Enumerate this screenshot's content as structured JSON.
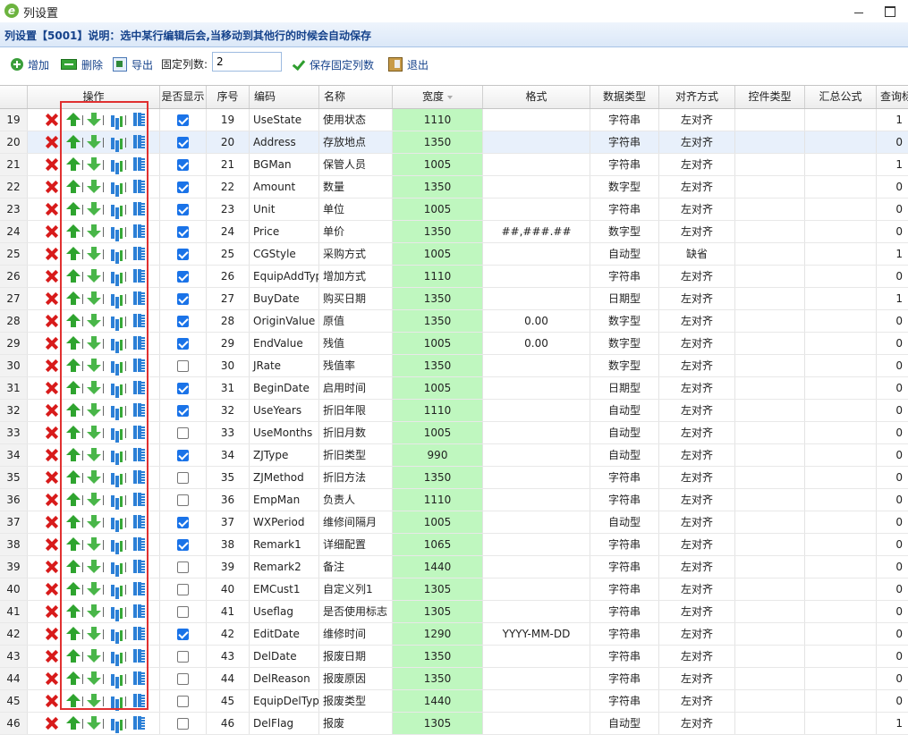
{
  "window": {
    "title": "列设置"
  },
  "info": {
    "text": "列设置【5001】说明：选中某行编辑后会,当移动到其他行的时候会自动保存"
  },
  "toolbar": {
    "add_label": "增加",
    "delete_label": "删除",
    "export_label": "导出",
    "fixed_cols_label": "固定列数:",
    "fixed_cols_value": "2",
    "save_fixed_label": "保存固定列数",
    "exit_label": "退出"
  },
  "columns": [
    "",
    "操作",
    "是否显示",
    "序号",
    "编码",
    "名称",
    "宽度",
    "格式",
    "数据类型",
    "对齐方式",
    "控件类型",
    "汇总公式",
    "查询标"
  ],
  "selected_row": 1,
  "rows": [
    {
      "rn": "19",
      "show": true,
      "seq": "19",
      "code": "UseState",
      "name": "使用状态",
      "width": "1110",
      "fmt": "",
      "type": "字符串",
      "align": "左对齐",
      "query": "1"
    },
    {
      "rn": "20",
      "show": true,
      "seq": "20",
      "code": "Address",
      "name": "存放地点",
      "width": "1350",
      "fmt": "",
      "type": "字符串",
      "align": "左对齐",
      "query": "0"
    },
    {
      "rn": "21",
      "show": true,
      "seq": "21",
      "code": "BGMan",
      "name": "保管人员",
      "width": "1005",
      "fmt": "",
      "type": "字符串",
      "align": "左对齐",
      "query": "1"
    },
    {
      "rn": "22",
      "show": true,
      "seq": "22",
      "code": "Amount",
      "name": "数量",
      "width": "1350",
      "fmt": "",
      "type": "数字型",
      "align": "左对齐",
      "query": "0"
    },
    {
      "rn": "23",
      "show": true,
      "seq": "23",
      "code": "Unit",
      "name": "单位",
      "width": "1005",
      "fmt": "",
      "type": "字符串",
      "align": "左对齐",
      "query": "0"
    },
    {
      "rn": "24",
      "show": true,
      "seq": "24",
      "code": "Price",
      "name": "单价",
      "width": "1350",
      "fmt": "##,###.##",
      "type": "数字型",
      "align": "左对齐",
      "query": "0"
    },
    {
      "rn": "25",
      "show": true,
      "seq": "25",
      "code": "CGStyle",
      "name": "采购方式",
      "width": "1005",
      "fmt": "",
      "type": "自动型",
      "align": "缺省",
      "query": "1"
    },
    {
      "rn": "26",
      "show": true,
      "seq": "26",
      "code": "EquipAddType",
      "name": "增加方式",
      "width": "1110",
      "fmt": "",
      "type": "字符串",
      "align": "左对齐",
      "query": "0"
    },
    {
      "rn": "27",
      "show": true,
      "seq": "27",
      "code": "BuyDate",
      "name": "购买日期",
      "width": "1350",
      "fmt": "",
      "type": "日期型",
      "align": "左对齐",
      "query": "1"
    },
    {
      "rn": "28",
      "show": true,
      "seq": "28",
      "code": "OriginValue",
      "name": "原值",
      "width": "1350",
      "fmt": "0.00",
      "type": "数字型",
      "align": "左对齐",
      "query": "0"
    },
    {
      "rn": "29",
      "show": true,
      "seq": "29",
      "code": "EndValue",
      "name": "残值",
      "width": "1005",
      "fmt": "0.00",
      "type": "数字型",
      "align": "左对齐",
      "query": "0"
    },
    {
      "rn": "30",
      "show": false,
      "seq": "30",
      "code": "JRate",
      "name": "残值率",
      "width": "1350",
      "fmt": "",
      "type": "数字型",
      "align": "左对齐",
      "query": "0"
    },
    {
      "rn": "31",
      "show": true,
      "seq": "31",
      "code": "BeginDate",
      "name": "启用时间",
      "width": "1005",
      "fmt": "",
      "type": "日期型",
      "align": "左对齐",
      "query": "0"
    },
    {
      "rn": "32",
      "show": true,
      "seq": "32",
      "code": "UseYears",
      "name": "折旧年限",
      "width": "1110",
      "fmt": "",
      "type": "自动型",
      "align": "左对齐",
      "query": "0"
    },
    {
      "rn": "33",
      "show": false,
      "seq": "33",
      "code": "UseMonths",
      "name": "折旧月数",
      "width": "1005",
      "fmt": "",
      "type": "自动型",
      "align": "左对齐",
      "query": "0"
    },
    {
      "rn": "34",
      "show": true,
      "seq": "34",
      "code": "ZJType",
      "name": "折旧类型",
      "width": "990",
      "fmt": "",
      "type": "自动型",
      "align": "左对齐",
      "query": "0"
    },
    {
      "rn": "35",
      "show": false,
      "seq": "35",
      "code": "ZJMethod",
      "name": "折旧方法",
      "width": "1350",
      "fmt": "",
      "type": "字符串",
      "align": "左对齐",
      "query": "0"
    },
    {
      "rn": "36",
      "show": false,
      "seq": "36",
      "code": "EmpMan",
      "name": "负责人",
      "width": "1110",
      "fmt": "",
      "type": "字符串",
      "align": "左对齐",
      "query": "0"
    },
    {
      "rn": "37",
      "show": true,
      "seq": "37",
      "code": "WXPeriod",
      "name": "维修间隔月",
      "width": "1005",
      "fmt": "",
      "type": "自动型",
      "align": "左对齐",
      "query": "0"
    },
    {
      "rn": "38",
      "show": true,
      "seq": "38",
      "code": "Remark1",
      "name": "详细配置",
      "width": "1065",
      "fmt": "",
      "type": "字符串",
      "align": "左对齐",
      "query": "0"
    },
    {
      "rn": "39",
      "show": false,
      "seq": "39",
      "code": "Remark2",
      "name": "备注",
      "width": "1440",
      "fmt": "",
      "type": "字符串",
      "align": "左对齐",
      "query": "0"
    },
    {
      "rn": "40",
      "show": false,
      "seq": "40",
      "code": "EMCust1",
      "name": "自定义列1",
      "width": "1305",
      "fmt": "",
      "type": "字符串",
      "align": "左对齐",
      "query": "0"
    },
    {
      "rn": "41",
      "show": false,
      "seq": "41",
      "code": "Useflag",
      "name": "是否使用标志",
      "width": "1305",
      "fmt": "",
      "type": "字符串",
      "align": "左对齐",
      "query": "0"
    },
    {
      "rn": "42",
      "show": true,
      "seq": "42",
      "code": "EditDate",
      "name": "维修时间",
      "width": "1290",
      "fmt": "YYYY-MM-DD",
      "type": "字符串",
      "align": "左对齐",
      "query": "0"
    },
    {
      "rn": "43",
      "show": false,
      "seq": "43",
      "code": "DelDate",
      "name": "报废日期",
      "width": "1350",
      "fmt": "",
      "type": "字符串",
      "align": "左对齐",
      "query": "0"
    },
    {
      "rn": "44",
      "show": false,
      "seq": "44",
      "code": "DelReason",
      "name": "报废原因",
      "width": "1350",
      "fmt": "",
      "type": "字符串",
      "align": "左对齐",
      "query": "0"
    },
    {
      "rn": "45",
      "show": false,
      "seq": "45",
      "code": "EquipDelType",
      "name": "报废类型",
      "width": "1440",
      "fmt": "",
      "type": "字符串",
      "align": "左对齐",
      "query": "0"
    },
    {
      "rn": "46",
      "show": false,
      "seq": "46",
      "code": "DelFlag",
      "name": "报废",
      "width": "1305",
      "fmt": "",
      "type": "自动型",
      "align": "左对齐",
      "query": "1"
    }
  ],
  "colors": {
    "highlight_frame": "#e03030",
    "width_column": "#bff7bf",
    "info_text": "#15428b"
  }
}
